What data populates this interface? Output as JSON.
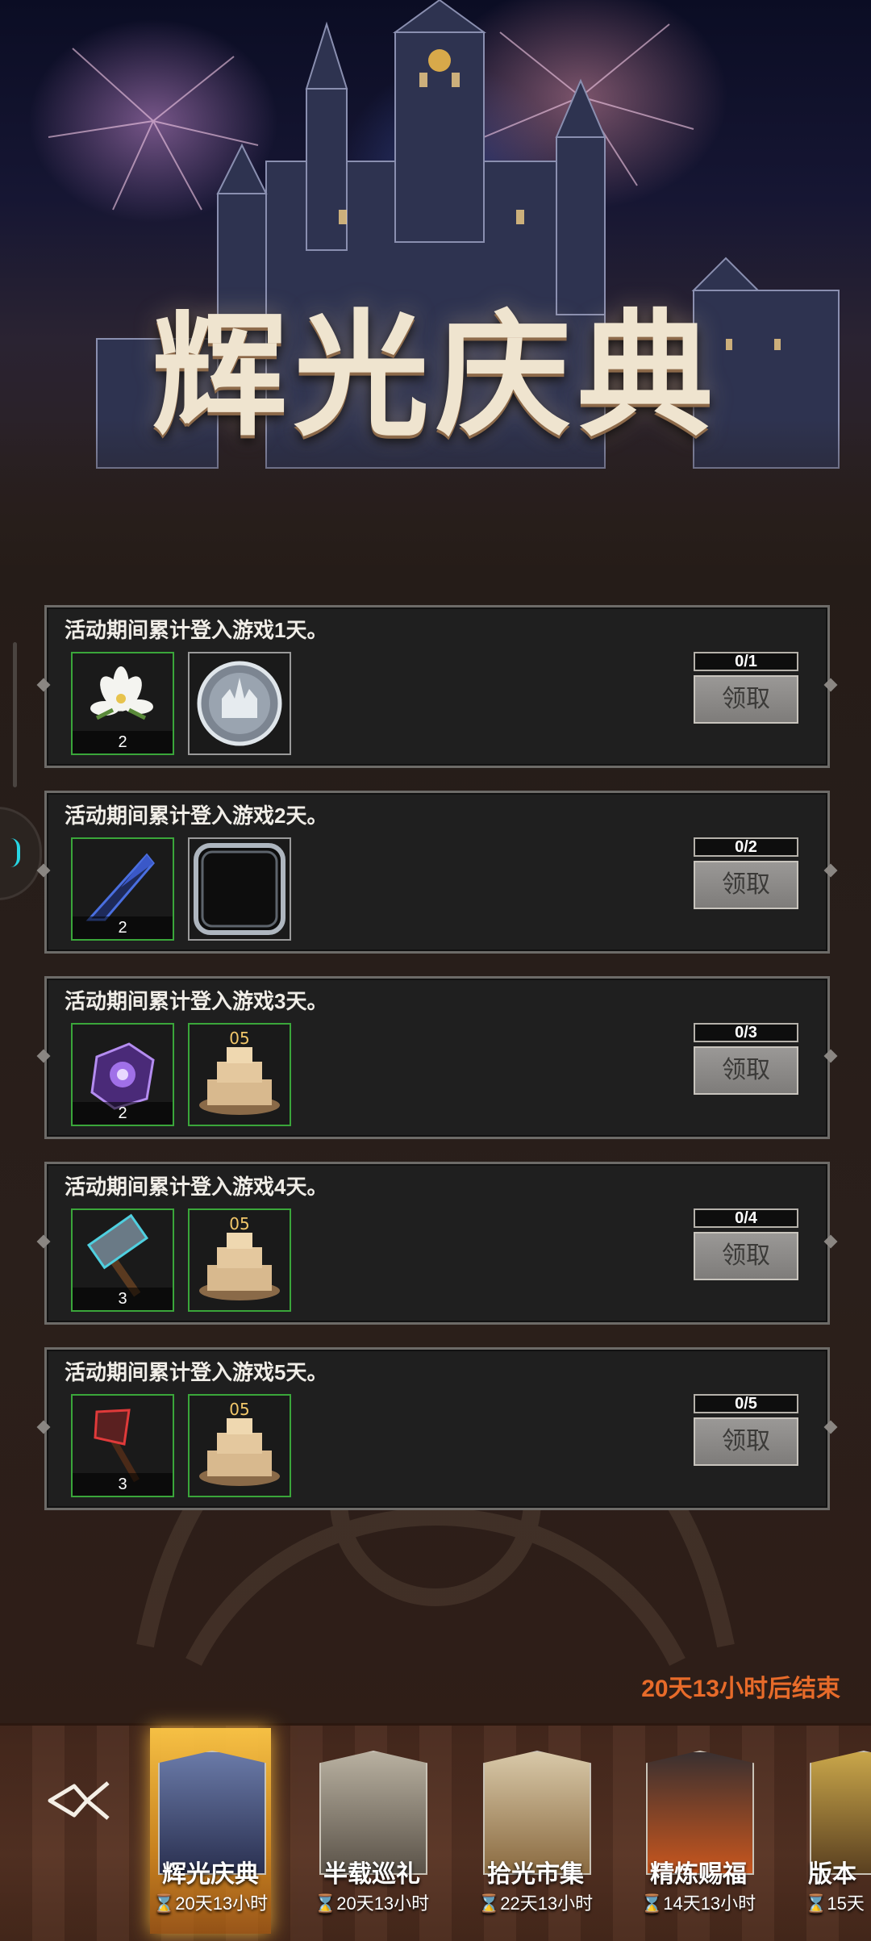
{
  "banner": {
    "title": "辉光庆典"
  },
  "tasks": [
    {
      "desc": "活动期间累计登入游戏1天。",
      "progress": "0/1",
      "claim": "领取",
      "items": [
        {
          "icon": "lily-flower-icon",
          "qty": "2"
        },
        {
          "icon": "silver-coin-icon",
          "qty": ""
        }
      ]
    },
    {
      "desc": "活动期间累计登入游戏2天。",
      "progress": "0/2",
      "claim": "领取",
      "items": [
        {
          "icon": "dark-blade-icon",
          "qty": "2"
        },
        {
          "icon": "avatar-frame-icon",
          "qty": ""
        }
      ]
    },
    {
      "desc": "活动期间累计登入游戏3天。",
      "progress": "0/3",
      "claim": "领取",
      "items": [
        {
          "icon": "purple-gem-box-icon",
          "qty": "2"
        },
        {
          "icon": "anniversary-cake-icon",
          "qty": ""
        }
      ]
    },
    {
      "desc": "活动期间累计登入游戏4天。",
      "progress": "0/4",
      "claim": "领取",
      "items": [
        {
          "icon": "war-hammer-icon",
          "qty": "3"
        },
        {
          "icon": "anniversary-cake-icon",
          "qty": ""
        }
      ]
    },
    {
      "desc": "活动期间累计登入游戏5天。",
      "progress": "0/5",
      "claim": "领取",
      "items": [
        {
          "icon": "red-axe-icon",
          "qty": "3"
        },
        {
          "icon": "anniversary-cake-icon",
          "qty": ""
        }
      ]
    }
  ],
  "end_time": "20天13小时后结束",
  "nav": [
    {
      "label": "辉光庆典",
      "time": "⌛20天13小时"
    },
    {
      "label": "半载巡礼",
      "time": "⌛20天13小时"
    },
    {
      "label": "拾光市集",
      "time": "⌛22天13小时"
    },
    {
      "label": "精炼赐福",
      "time": "⌛14天13小时"
    },
    {
      "label": "版本",
      "time": "⌛15天"
    }
  ],
  "colors": {
    "accent": "#e76b2a",
    "slot_border": "#3aa63a",
    "progress_cyan": "#27d5e3"
  }
}
